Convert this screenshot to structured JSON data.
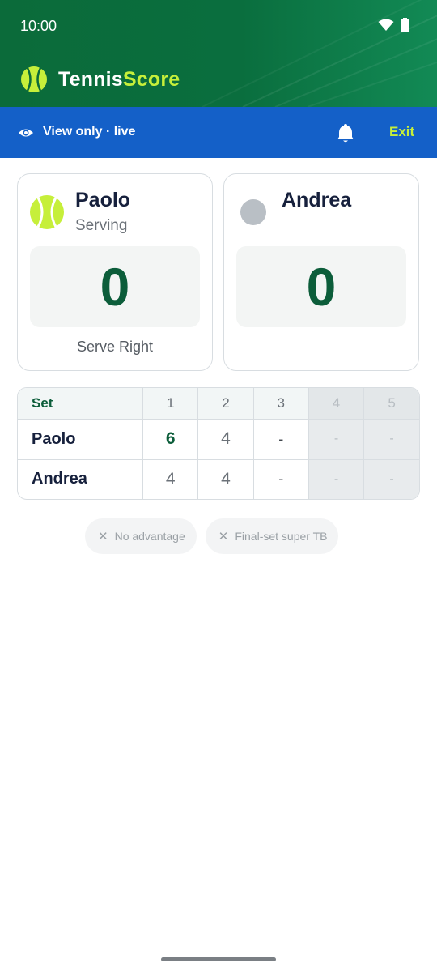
{
  "status_bar": {
    "time": "10:00",
    "wifi_icon": "wifi-icon",
    "battery_icon": "battery-icon"
  },
  "brand": {
    "name_part1": "Tennis",
    "name_part2": "Score",
    "logo_icon": "tennis-ball-icon",
    "color_part2": "#c6ef3a"
  },
  "view_bar": {
    "label": "View only · live",
    "eye_icon": "eye-icon",
    "bell_icon": "bell-icon",
    "exit_label": "Exit",
    "background": "#1460c8"
  },
  "players": [
    {
      "name": "Paolo",
      "status": "Serving",
      "score": "0",
      "serve_side": "Serve Right",
      "indicator": "tennis-ball-icon"
    },
    {
      "name": "Andrea",
      "status": "",
      "score": "0",
      "serve_side": "",
      "indicator": "grey-dot-icon"
    }
  ],
  "sets": {
    "header_label": "Set",
    "columns": [
      "1",
      "2",
      "3",
      "4",
      "5"
    ],
    "rows": [
      {
        "name": "Paolo",
        "scores": [
          "6",
          "4",
          "-",
          "-",
          "-"
        ]
      },
      {
        "name": "Andrea",
        "scores": [
          "4",
          "4",
          "-",
          "-",
          "-"
        ]
      }
    ]
  },
  "chips": [
    {
      "label": "No advantage",
      "icon": "close-icon"
    },
    {
      "label": "Final-set super TB",
      "icon": "close-icon"
    }
  ],
  "colors": {
    "header_green": "#0b6b3a",
    "score_green": "#0c5d3a",
    "accent_lime": "#c6ef3a"
  }
}
